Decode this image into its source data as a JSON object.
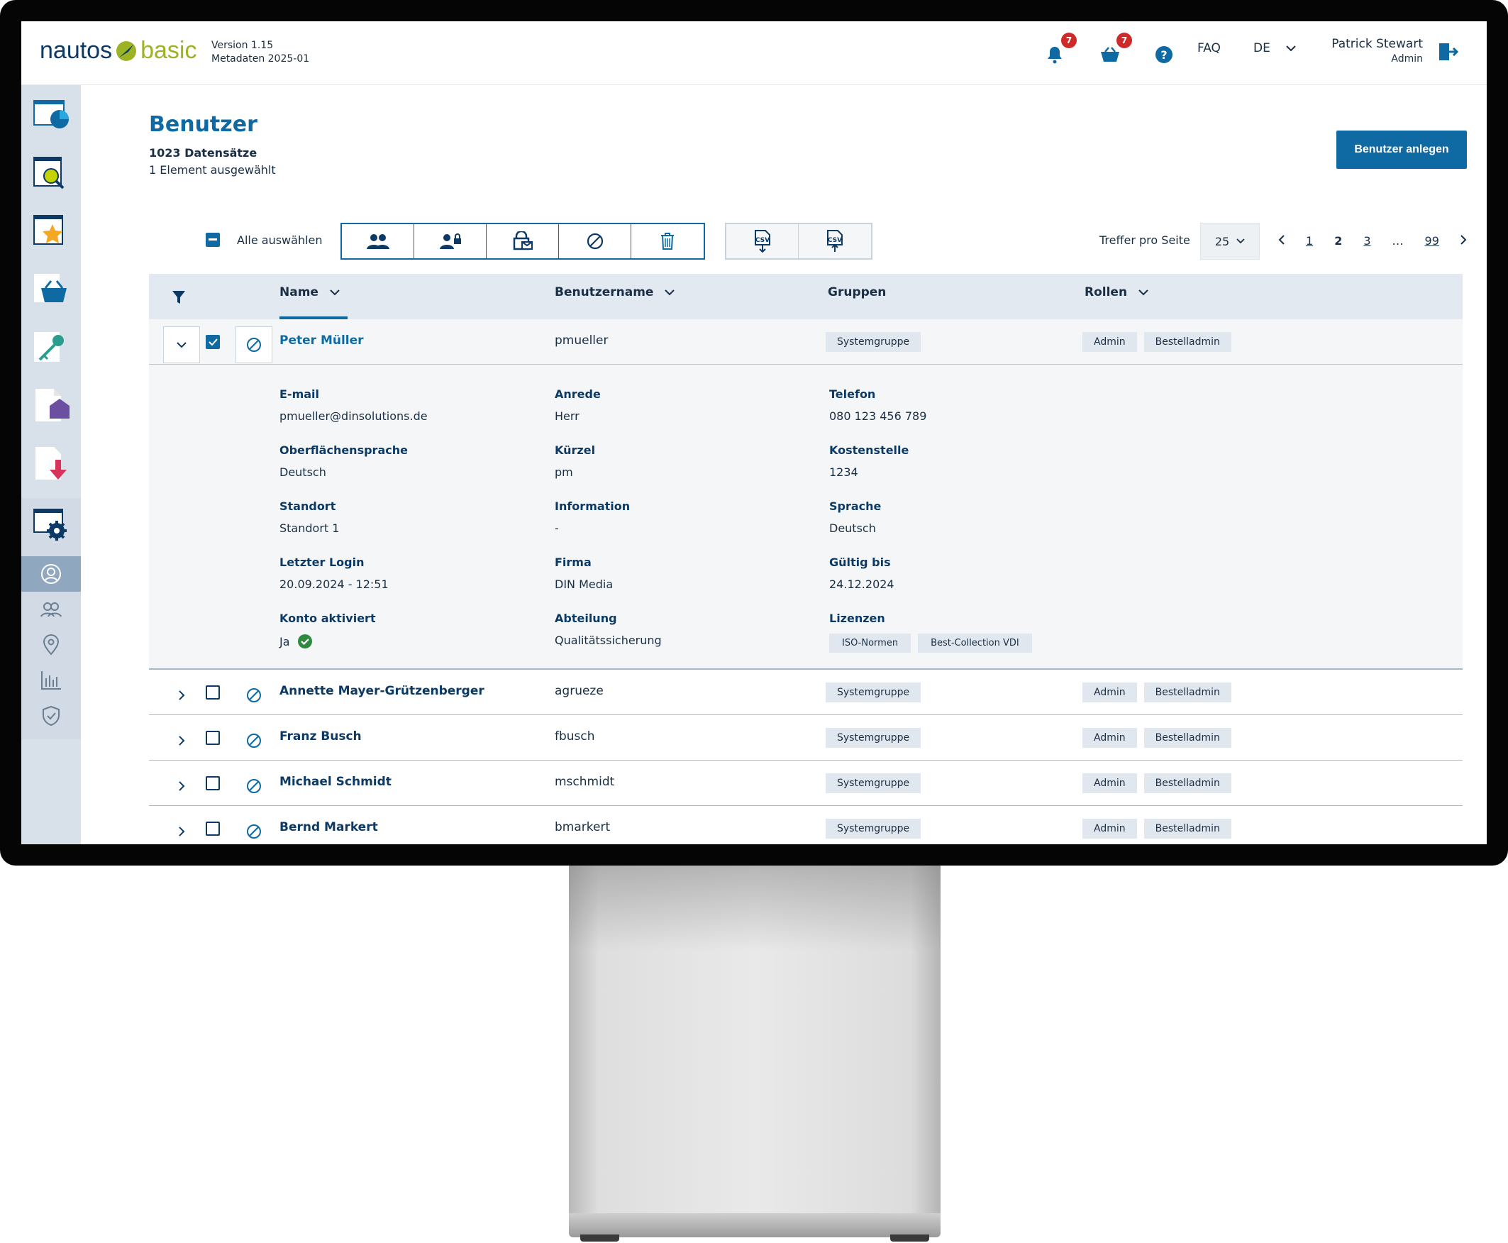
{
  "header": {
    "logo_left": "nautos",
    "logo_right": "basic",
    "version": "Version 1.15",
    "metadata": "Metadaten 2025-01",
    "notifications_count": "7",
    "cart_count": "7",
    "faq": "FAQ",
    "language": "DE",
    "user_name": "Patrick Stewart",
    "user_role": "Admin"
  },
  "page": {
    "title": "Benutzer",
    "record_count": "1023 Datensätze",
    "selection_info": "1 Element ausgewählt",
    "create_button": "Benutzer anlegen"
  },
  "toolbar": {
    "select_all": "Alle auswählen",
    "per_page_label": "Treffer pro Seite",
    "per_page_value": "25",
    "pages": [
      "1",
      "2",
      "3",
      "…",
      "99"
    ],
    "current_page": "2"
  },
  "table": {
    "columns": {
      "name": "Name",
      "username": "Benutzername",
      "groups": "Gruppen",
      "roles": "Rollen"
    },
    "rows": [
      {
        "name": "Peter Müller",
        "username": "pmueller",
        "group": "Systemgruppe",
        "roles": [
          "Admin",
          "Bestelladmin"
        ]
      },
      {
        "name": "Annette Mayer-Grützenberger",
        "username": "agrueze",
        "group": "Systemgruppe",
        "roles": [
          "Admin",
          "Bestelladmin"
        ]
      },
      {
        "name": "Franz Busch",
        "username": "fbusch",
        "group": "Systemgruppe",
        "roles": [
          "Admin",
          "Bestelladmin"
        ]
      },
      {
        "name": "Michael Schmidt",
        "username": "mschmidt",
        "group": "Systemgruppe",
        "roles": [
          "Admin",
          "Bestelladmin"
        ]
      },
      {
        "name": "Bernd Markert",
        "username": "bmarkert",
        "group": "Systemgruppe",
        "roles": [
          "Admin",
          "Bestelladmin"
        ]
      }
    ]
  },
  "details": {
    "email_label": "E-mail",
    "email": "pmueller@dinsolutions.de",
    "salutation_label": "Anrede",
    "salutation": "Herr",
    "phone_label": "Telefon",
    "phone": "080 123 456 789",
    "ui_lang_label": "Oberflächensprache",
    "ui_lang": "Deutsch",
    "short_label": "Kürzel",
    "short": "pm",
    "cost_center_label": "Kostenstelle",
    "cost_center": "1234",
    "location_label": "Standort",
    "location": "Standort 1",
    "info_label": "Information",
    "info": "-",
    "lang_label": "Sprache",
    "lang": "Deutsch",
    "last_login_label": "Letzter Login",
    "last_login": "20.09.2024 - 12:51",
    "company_label": "Firma",
    "company": "DIN Media",
    "valid_label": "Gültig bis",
    "valid": "24.12.2024",
    "active_label": "Konto aktiviert",
    "active": "Ja",
    "department_label": "Abteilung",
    "department": "Qualitätssicherung",
    "licenses_label": "Lizenzen",
    "licenses": [
      "ISO-Normen",
      "Best-Collection VDI"
    ]
  },
  "colors": {
    "primary": "#0f6aa3",
    "dark": "#0c3a64",
    "logo_green": "#9bb325",
    "badge_red": "#cf2a2a",
    "header_bg": "#e3e9f0",
    "sidebar_bg": "#d8e0e9"
  },
  "icons": {
    "sidebar": [
      "dashboard-icon",
      "search-icon",
      "favorites-icon",
      "basket-icon",
      "key-icon",
      "document-home-icon",
      "download-icon",
      "settings-icon"
    ],
    "admin_sub": [
      "user-icon",
      "users-icon",
      "location-icon",
      "statistics-icon",
      "shield-icon"
    ]
  }
}
